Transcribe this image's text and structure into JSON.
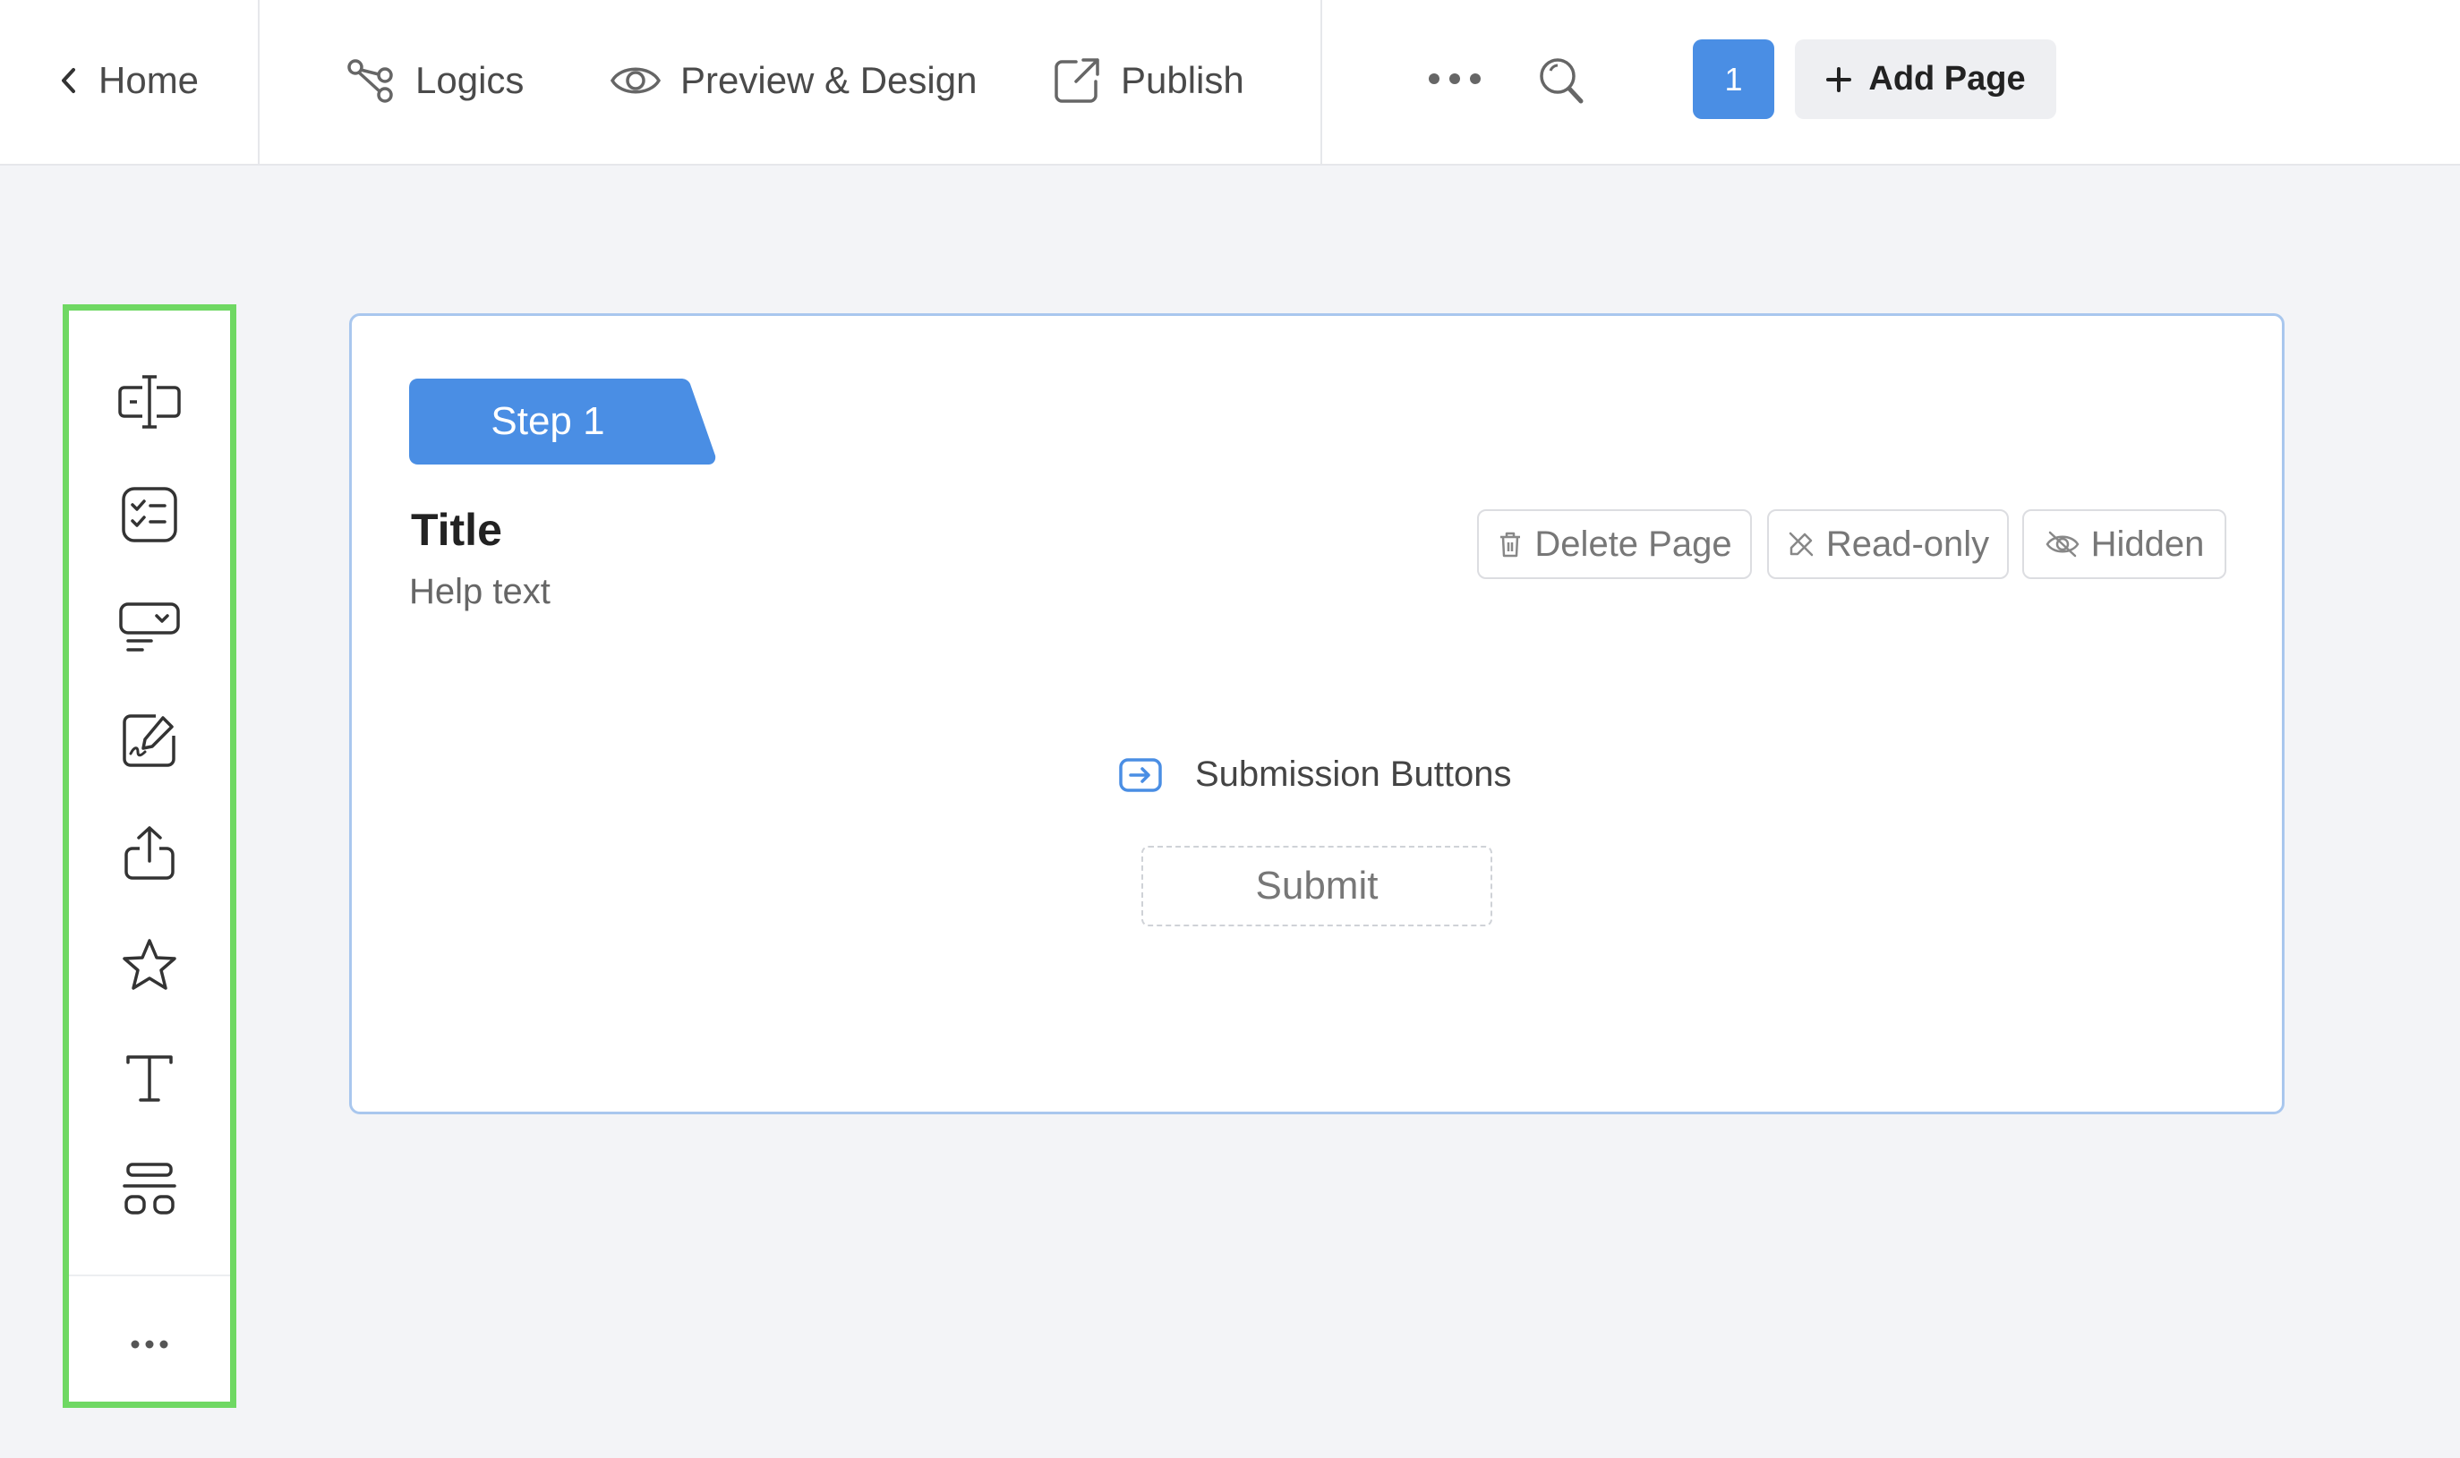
{
  "header": {
    "home_label": "Home",
    "nav": {
      "logics": "Logics",
      "preview_design": "Preview & Design",
      "publish": "Publish"
    },
    "current_page_number": "1",
    "add_page_label": "Add Page"
  },
  "sidebar": {
    "border_color": "#6fd863",
    "tools": [
      {
        "icon": "text-field-icon"
      },
      {
        "icon": "checklist-icon"
      },
      {
        "icon": "dropdown-select-icon"
      },
      {
        "icon": "signature-icon"
      },
      {
        "icon": "upload-icon"
      },
      {
        "icon": "star-rating-icon"
      },
      {
        "icon": "text-format-icon"
      },
      {
        "icon": "layout-icon"
      }
    ],
    "more_icon": "more-horizontal-icon"
  },
  "page": {
    "step_label": "Step 1",
    "title": "Title",
    "help_text": "Help text",
    "actions": {
      "delete": "Delete Page",
      "readonly": "Read-only",
      "hidden": "Hidden"
    },
    "submission_label": "Submission Buttons",
    "submit_label": "Submit"
  },
  "colors": {
    "accent": "#4a8ee4",
    "card_border": "#a9c7ee",
    "background": "#f3f4f7"
  }
}
